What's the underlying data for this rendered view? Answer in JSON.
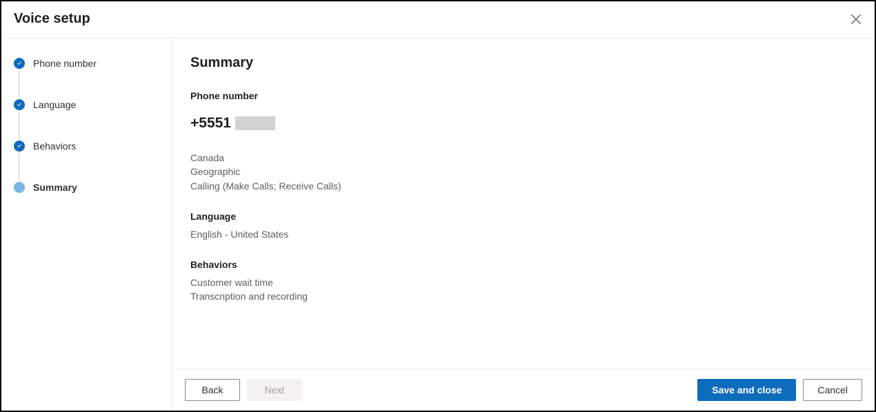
{
  "header": {
    "title": "Voice setup"
  },
  "sidebar": {
    "steps": [
      {
        "label": "Phone number",
        "state": "completed"
      },
      {
        "label": "Language",
        "state": "completed"
      },
      {
        "label": "Behaviors",
        "state": "completed"
      },
      {
        "label": "Summary",
        "state": "current"
      }
    ]
  },
  "summary": {
    "title": "Summary",
    "phone_section": {
      "heading": "Phone number",
      "value": "+5551",
      "country": "Canada",
      "number_type": "Geographic",
      "features": "Calling (Make Calls; Receive Calls)"
    },
    "language_section": {
      "heading": "Language",
      "value": "English - United States"
    },
    "behaviors_section": {
      "heading": "Behaviors",
      "items": [
        "Customer wait time",
        "Transcription and recording"
      ]
    }
  },
  "footer": {
    "back": "Back",
    "next": "Next",
    "save": "Save and close",
    "cancel": "Cancel"
  }
}
